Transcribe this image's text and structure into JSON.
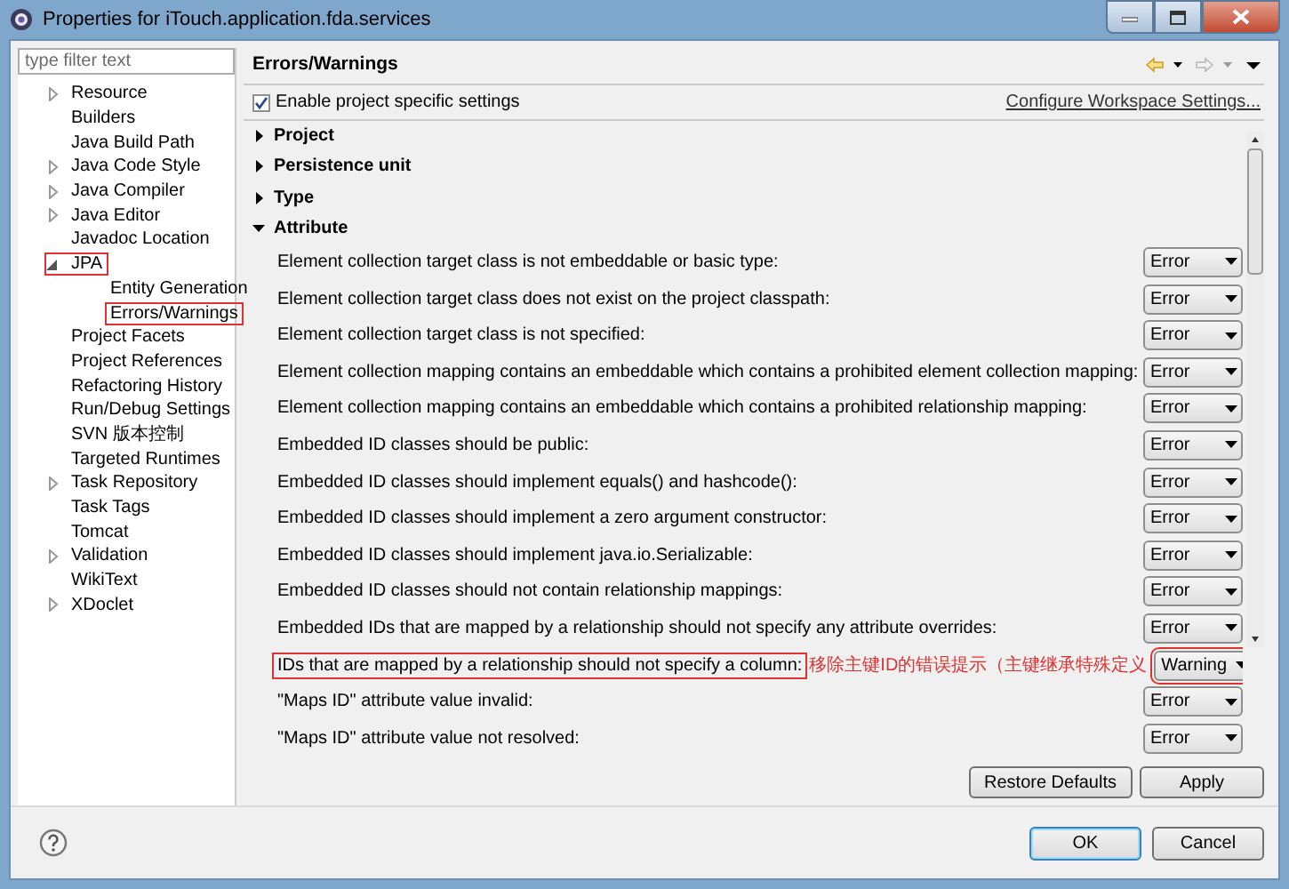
{
  "window": {
    "title": "Properties for iTouch.application.fda.services"
  },
  "filter": {
    "placeholder": "type filter text"
  },
  "tree": [
    {
      "label": "Resource",
      "expanded": false,
      "annotated": false
    },
    {
      "label": "Builders",
      "annotated": false
    },
    {
      "label": "Java Build Path",
      "annotated": false
    },
    {
      "label": "Java Code Style",
      "expanded": false,
      "annotated": false
    },
    {
      "label": "Java Compiler",
      "expanded": false,
      "annotated": false
    },
    {
      "label": "Java Editor",
      "expanded": false,
      "annotated": false
    },
    {
      "label": "Javadoc Location",
      "annotated": false
    },
    {
      "label": "JPA",
      "expanded": true,
      "annotated": true,
      "children": [
        {
          "label": "Entity Generation",
          "annotated": false
        },
        {
          "label": "Errors/Warnings",
          "annotated": true
        }
      ]
    },
    {
      "label": "Project Facets",
      "annotated": false
    },
    {
      "label": "Project References",
      "annotated": false
    },
    {
      "label": "Refactoring History",
      "annotated": false
    },
    {
      "label": "Run/Debug Settings",
      "annotated": false
    },
    {
      "label": "SVN 版本控制",
      "annotated": false
    },
    {
      "label": "Targeted Runtimes",
      "annotated": false
    },
    {
      "label": "Task Repository",
      "expanded": false,
      "annotated": false
    },
    {
      "label": "Task Tags",
      "annotated": false
    },
    {
      "label": "Tomcat",
      "annotated": false
    },
    {
      "label": "Validation",
      "expanded": false,
      "annotated": false
    },
    {
      "label": "WikiText",
      "annotated": false
    },
    {
      "label": "XDoclet",
      "expanded": false,
      "annotated": false
    }
  ],
  "page": {
    "title": "Errors/Warnings",
    "enable": {
      "label": "Enable project specific settings",
      "checked": true
    },
    "configure_link": "Configure Workspace Settings...",
    "sections": [
      {
        "label": "Project",
        "expanded": false
      },
      {
        "label": "Persistence unit",
        "expanded": false
      },
      {
        "label": "Type",
        "expanded": false
      },
      {
        "label": "Attribute",
        "expanded": true
      }
    ],
    "rows": [
      {
        "label": "Element collection target class is not embeddable or basic type:",
        "value": "Error",
        "annotated": false
      },
      {
        "label": "Element collection target class does not exist on the project classpath:",
        "value": "Error",
        "annotated": false
      },
      {
        "label": "Element collection target class is not specified:",
        "value": "Error",
        "annotated": false
      },
      {
        "label": "Element collection mapping contains an embeddable which contains a prohibited element collection mapping:",
        "value": "Error",
        "annotated": false
      },
      {
        "label": "Element collection mapping contains an embeddable which contains a prohibited relationship mapping:",
        "value": "Error",
        "annotated": false
      },
      {
        "label": "Embedded ID classes should be public:",
        "value": "Error",
        "annotated": false
      },
      {
        "label": "Embedded ID classes should implement equals() and hashcode():",
        "value": "Error",
        "annotated": false
      },
      {
        "label": "Embedded ID classes should implement a zero argument constructor:",
        "value": "Error",
        "annotated": false
      },
      {
        "label": "Embedded ID classes should implement java.io.Serializable:",
        "value": "Error",
        "annotated": false
      },
      {
        "label": "Embedded ID classes should not contain relationship mappings:",
        "value": "Error",
        "annotated": false
      },
      {
        "label": "Embedded IDs that are mapped by a relationship should not specify any attribute overrides:",
        "value": "Error",
        "annotated": false
      },
      {
        "label": "IDs that are mapped by a relationship should not specify a column:",
        "value": "Warning",
        "annotated": true,
        "note": "移除主键ID的错误提示（主键继承特殊定义"
      },
      {
        "label": "\"Maps ID\" attribute value invalid:",
        "value": "Error",
        "annotated": false
      },
      {
        "label": "\"Maps ID\" attribute value not resolved:",
        "value": "Error",
        "annotated": false
      }
    ],
    "restore_button": "Restore Defaults",
    "apply_button": "Apply"
  },
  "buttons": [
    {
      "label": "OK",
      "default": true
    },
    {
      "label": "Cancel",
      "default": false
    }
  ]
}
